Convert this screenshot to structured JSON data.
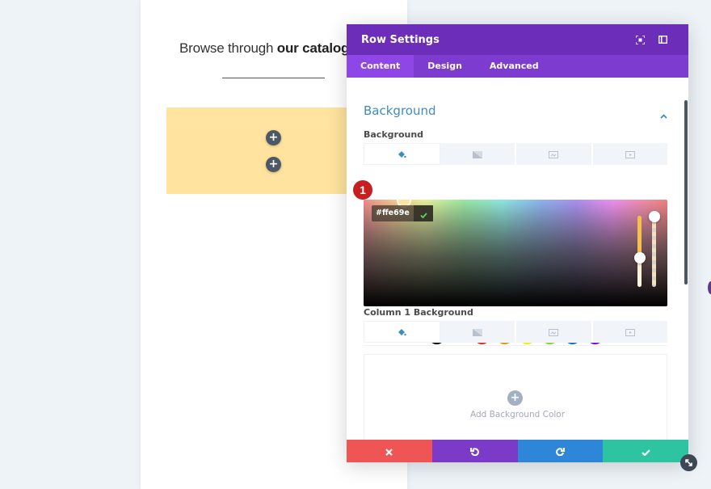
{
  "page": {
    "heading_light": "Browse through ",
    "heading_bold": "our catalog",
    "row_color": "#ffe39e"
  },
  "modal": {
    "title": "Row Settings",
    "header_icons": [
      "focus-mode-icon",
      "sidebar-toggle-icon"
    ],
    "tabs": [
      {
        "label": "Content",
        "active": true
      },
      {
        "label": "Design",
        "active": false
      },
      {
        "label": "Advanced",
        "active": false
      }
    ],
    "section": {
      "title": "Background",
      "expanded": true
    },
    "background": {
      "label": "Background",
      "type_tabs": [
        "color-fill-icon",
        "gradient-icon",
        "image-icon",
        "video-icon"
      ],
      "active_type": 0,
      "hex_value": "#ffe69e",
      "step_badge": "1",
      "hue_slider_level": 0.4,
      "opacity_slider_level": 1.0,
      "swatches": [
        "#000000",
        "#ffffff",
        "#e02b20",
        "#e09900",
        "#edf000",
        "#7cda24",
        "#0c71c3",
        "#8300e9"
      ]
    },
    "column_background": {
      "label": "Column 1 Background",
      "type_tabs": [
        "color-fill-icon",
        "gradient-icon",
        "image-icon",
        "video-icon"
      ],
      "active_type": 0,
      "add_label": "Add Background Color"
    },
    "footer": {
      "buttons": [
        {
          "name": "cancel",
          "color": "#ef5555"
        },
        {
          "name": "undo",
          "color": "#7b3ac8"
        },
        {
          "name": "redo",
          "color": "#2e86d8"
        },
        {
          "name": "save",
          "color": "#2ec4a2"
        }
      ]
    }
  }
}
